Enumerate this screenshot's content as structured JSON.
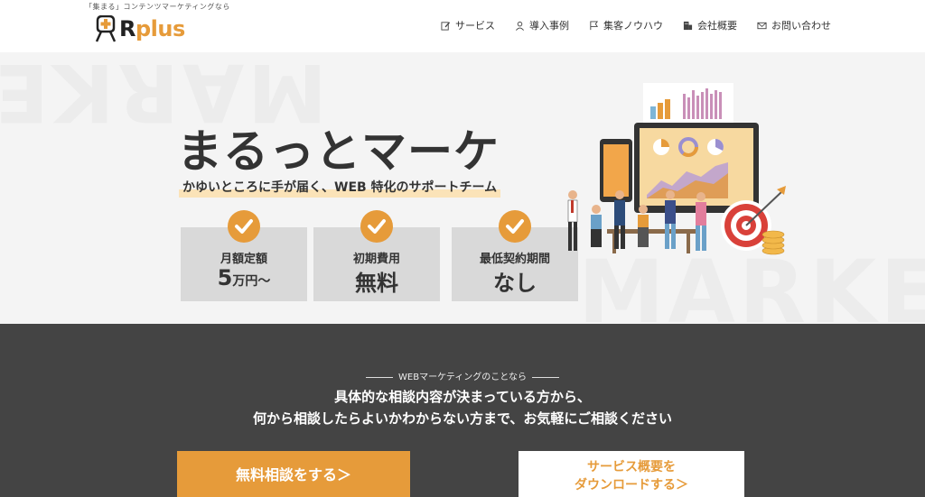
{
  "header": {
    "tagline": "「集まる」コンテンツマーケティングなら",
    "logo": {
      "prefix": "R",
      "suffix": "plus"
    },
    "nav": [
      {
        "label": "サービス",
        "icon": "edit-icon"
      },
      {
        "label": "導入事例",
        "icon": "user-icon"
      },
      {
        "label": "集客ノウハウ",
        "icon": "flag-icon"
      },
      {
        "label": "会社概要",
        "icon": "building-icon"
      },
      {
        "label": "お問い合わせ",
        "icon": "mail-icon"
      }
    ]
  },
  "hero": {
    "bg_word_top": "MARKE",
    "bg_word_bottom": "MARKET",
    "title": "まるっとマーケ",
    "subtitle": "かゆいところに手が届く、WEB 特化のサポートチーム",
    "features": [
      {
        "label": "月額定額",
        "value": "5",
        "unit": "万円〜"
      },
      {
        "label": "初期費用",
        "value": "無料",
        "unit": ""
      },
      {
        "label": "最低契約期間",
        "value": "なし",
        "unit": ""
      }
    ]
  },
  "cta_section": {
    "small_heading": "WEBマーケティングのことなら",
    "line1": "具体的な相談内容が決まっている方から、",
    "line2": "何から相談したらよいかわからない方まで、お気軽にご相談ください",
    "primary_button": "無料相談をする＞",
    "secondary_button_line1": "サービス概要を",
    "secondary_button_line2": "ダウンロードする＞"
  },
  "colors": {
    "accent": "#e69b3a",
    "dark_bg": "#444444",
    "hero_bg": "#f4f4f4"
  }
}
